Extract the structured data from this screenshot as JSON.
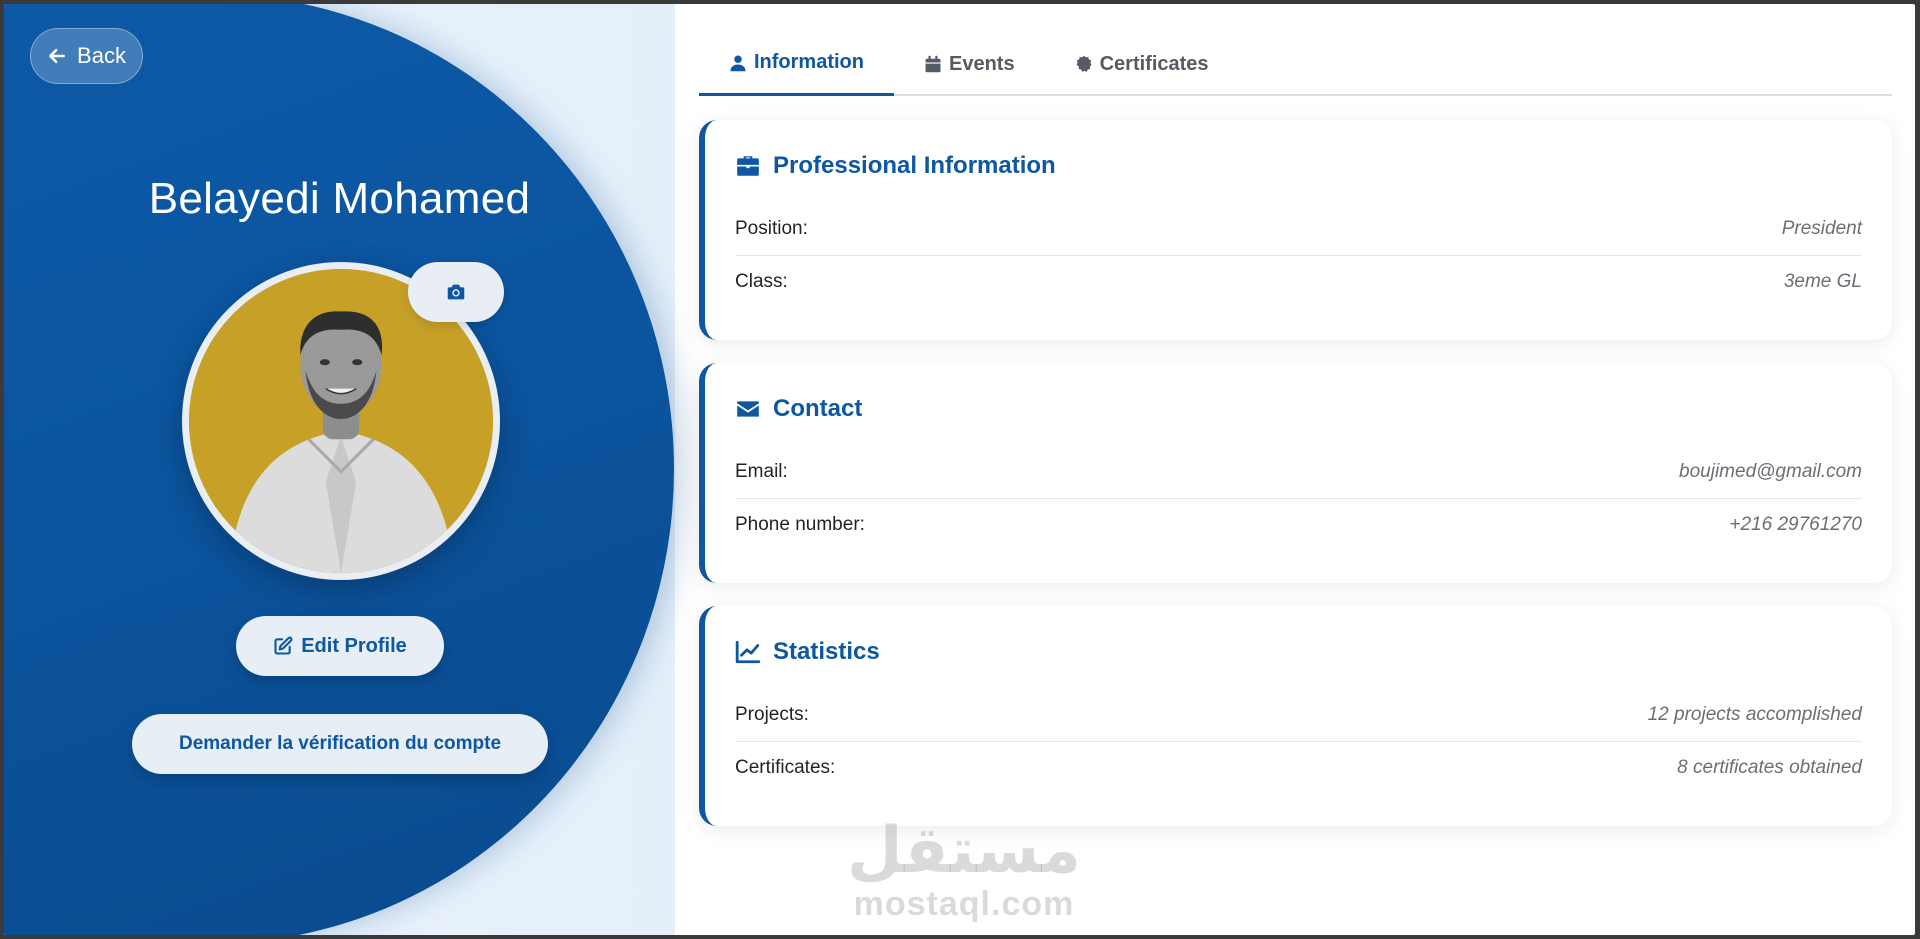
{
  "nav": {
    "back_label": "Back"
  },
  "profile": {
    "name": "Belayedi Mohamed",
    "edit_label": "Edit Profile",
    "verify_label": "Demander la vérification du compte"
  },
  "tabs": [
    {
      "label": "Information",
      "icon": "user-icon",
      "active": true
    },
    {
      "label": "Events",
      "icon": "calendar-icon",
      "active": false
    },
    {
      "label": "Certificates",
      "icon": "certificate-icon",
      "active": false
    }
  ],
  "sections": {
    "professional": {
      "title": "Professional Information",
      "icon": "briefcase-icon",
      "rows": [
        {
          "label": "Position:",
          "value": "President"
        },
        {
          "label": "Class:",
          "value": "3eme GL"
        }
      ]
    },
    "contact": {
      "title": "Contact",
      "icon": "envelope-icon",
      "rows": [
        {
          "label": "Email:",
          "value": "boujimed@gmail.com"
        },
        {
          "label": "Phone number:",
          "value": "+216 29761270"
        }
      ]
    },
    "statistics": {
      "title": "Statistics",
      "icon": "chart-line-icon",
      "rows": [
        {
          "label": "Projects:",
          "value": "12 projects accomplished"
        },
        {
          "label": "Certificates:",
          "value": "8 certificates obtained"
        }
      ]
    }
  },
  "watermark": {
    "arabic": "مستقل",
    "latin": "mostaql.com"
  },
  "colors": {
    "primary": "#0d57a3",
    "avatar_bg": "#c7a028",
    "panel_bg": "#0b55a0"
  }
}
